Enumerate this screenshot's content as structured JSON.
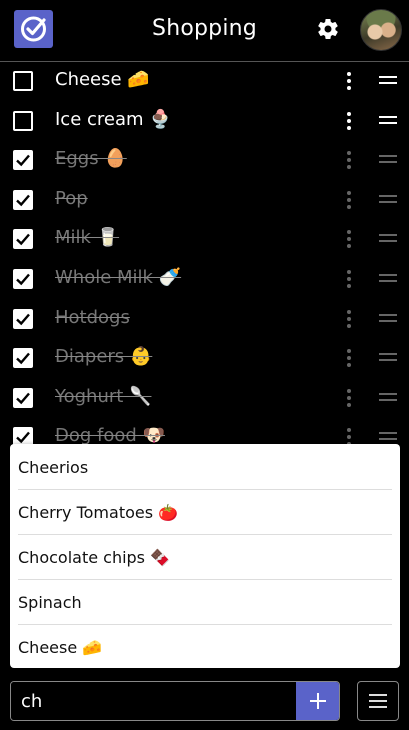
{
  "header": {
    "title": "Shopping"
  },
  "items": [
    {
      "label": "Cheese 🧀",
      "checked": false
    },
    {
      "label": "Ice cream 🍨",
      "checked": false
    },
    {
      "label": "Eggs 🥚",
      "checked": true
    },
    {
      "label": "Pop",
      "checked": true
    },
    {
      "label": "Milk 🥛",
      "checked": true
    },
    {
      "label": "Whole Milk 🍼",
      "checked": true
    },
    {
      "label": "Hotdogs",
      "checked": true
    },
    {
      "label": "Diapers 👶",
      "checked": true
    },
    {
      "label": "Yoghurt 🥄",
      "checked": true
    },
    {
      "label": "Dog food 🐶",
      "checked": true
    }
  ],
  "suggestions": [
    "Cheerios",
    "Cherry Tomatoes 🍅",
    "Chocolate chips 🍫",
    "Spinach",
    "Cheese 🧀"
  ],
  "input": {
    "value": "ch"
  },
  "colors": {
    "accent": "#5a63c9",
    "background": "#000000",
    "done_text": "#777777"
  }
}
